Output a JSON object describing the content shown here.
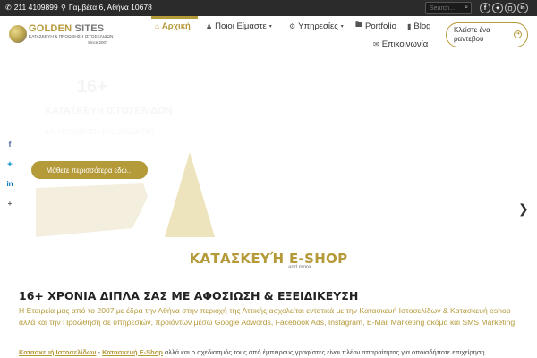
{
  "topbar": {
    "phone": "211 4109899",
    "address": "Γαμβέτα 6, Αθήνα 10678",
    "search_placeholder": "Search...",
    "social": [
      "f",
      "t",
      "ig",
      "in"
    ]
  },
  "logo": {
    "brand_a": "GOLDEN",
    "brand_b": "SITES",
    "tagline": "ΚΑΤΑΣΚΕΥΗ & ΠΡΟΩΘΗΣΗ ΙΣΤΟΣΕΛΙΔΩΝ",
    "since": "Since 2007"
  },
  "nav": {
    "items": [
      {
        "label": "Αρχική",
        "icon": "home-icon",
        "active": true
      },
      {
        "label": "Ποιοι Είμαστε",
        "icon": "users-icon",
        "dropdown": true
      },
      {
        "label": "Υπηρεσίες",
        "icon": "gear-icon",
        "dropdown": true
      },
      {
        "label": "Portfolio",
        "icon": "folder-icon"
      },
      {
        "label": "Blog",
        "icon": "book-icon"
      },
      {
        "label": "Επικοινωνία",
        "icon": "envelope-icon"
      }
    ],
    "cta_line1": "Κλείστε ένα",
    "cta_line2": "ραντεβού"
  },
  "hero": {
    "ghost_number": "16+",
    "ghost_title": "ΚΑΤΑΣΚΕΥΗ ΙΣΤΟΣΕΛΙΔΩΝ",
    "ghost_sub": "ΚΑΙ ΠΡΟΩΘΗΣΗ ΣΤΟ ΔΙΑΔΙΚΤΥΟ",
    "button": "Μάθετε περισσότερα εδώ...",
    "share": [
      "f",
      "t",
      "in",
      "+"
    ]
  },
  "section": {
    "big_title": "ΚΑΤΑΣΚΕΥΉ E-SHOP",
    "and_more": "and more...",
    "heading": "16+ ΧΡΟΝΙΑ ΔΙΠΛΑ ΣΑΣ ΜΕ ΑΦΟΣΙΩΣΗ & ΕΞΕΙΔΙΚΕΥΣΗ",
    "para1": "Η Εταιρεία μας από το 2007 με έδρα την Αθήνα στην περιοχή της Αττικής ασχολείται εντατικά με την Κατασκευή Ιστοσελίδων & Κατασκευή eshop αλλά και την Προώθηση σε υπηρεσιών, προϊόντων μέσω Google Adwords, Facebook Ads, Instagram, E-Mail Marketing ακόμα και SMS Marketing.",
    "para2_link1": "Κατασκευή Ιστοσελίδων",
    "para2_sep": " - ",
    "para2_link2": "Κατασκευή E-Shop",
    "para2_rest": " αλλά και ο σχεδιασμός τους από έμπειρους γραφίστες είναι πλέον απαραίτητος για οποιαδήποτε επιχείρηση"
  }
}
